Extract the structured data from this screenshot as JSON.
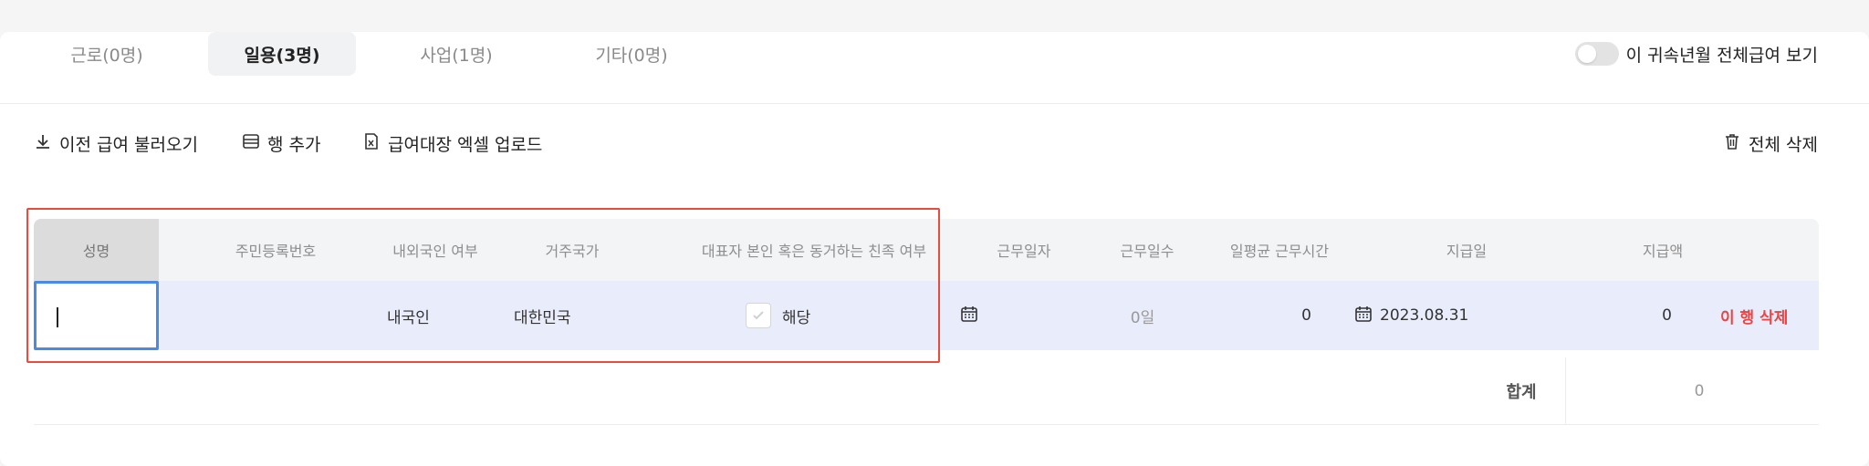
{
  "tabs": [
    {
      "label": "근로(0명)",
      "active": false
    },
    {
      "label": "일용(3명)",
      "active": true
    },
    {
      "label": "사업(1명)",
      "active": false
    },
    {
      "label": "기타(0명)",
      "active": false
    }
  ],
  "toggle": {
    "label": "이 귀속년월 전체급여 보기",
    "on": false
  },
  "toolbar": {
    "load_previous": "이전 급여 불러오기",
    "add_row": "행 추가",
    "upload_excel": "급여대장 엑셀 업로드",
    "delete_all": "전체 삭제"
  },
  "table": {
    "headers": {
      "name": "성명",
      "resident_no": "주민등록번호",
      "nationality": "내외국인 여부",
      "country": "거주국가",
      "relative": "대표자 본인 혹은 동거하는 친족 여부",
      "work_date": "근무일자",
      "work_days": "근무일수",
      "avg_hours": "일평균 근무시간",
      "pay_date": "지급일",
      "pay_amount": "지급액"
    },
    "row": {
      "name": "",
      "resident_no": "",
      "nationality": "내국인",
      "country": "대한민국",
      "relative_label": "해당",
      "work_date": "",
      "work_days": "0일",
      "avg_hours": "0",
      "pay_date": "2023.08.31",
      "pay_amount": "0",
      "delete": "이 행 삭제"
    },
    "total": {
      "label": "합계",
      "value": "0"
    }
  },
  "colors": {
    "accent": "#4a8ae4",
    "danger": "#e54747",
    "highlight": "#e74c3c",
    "row_bg": "#e9edfb"
  }
}
